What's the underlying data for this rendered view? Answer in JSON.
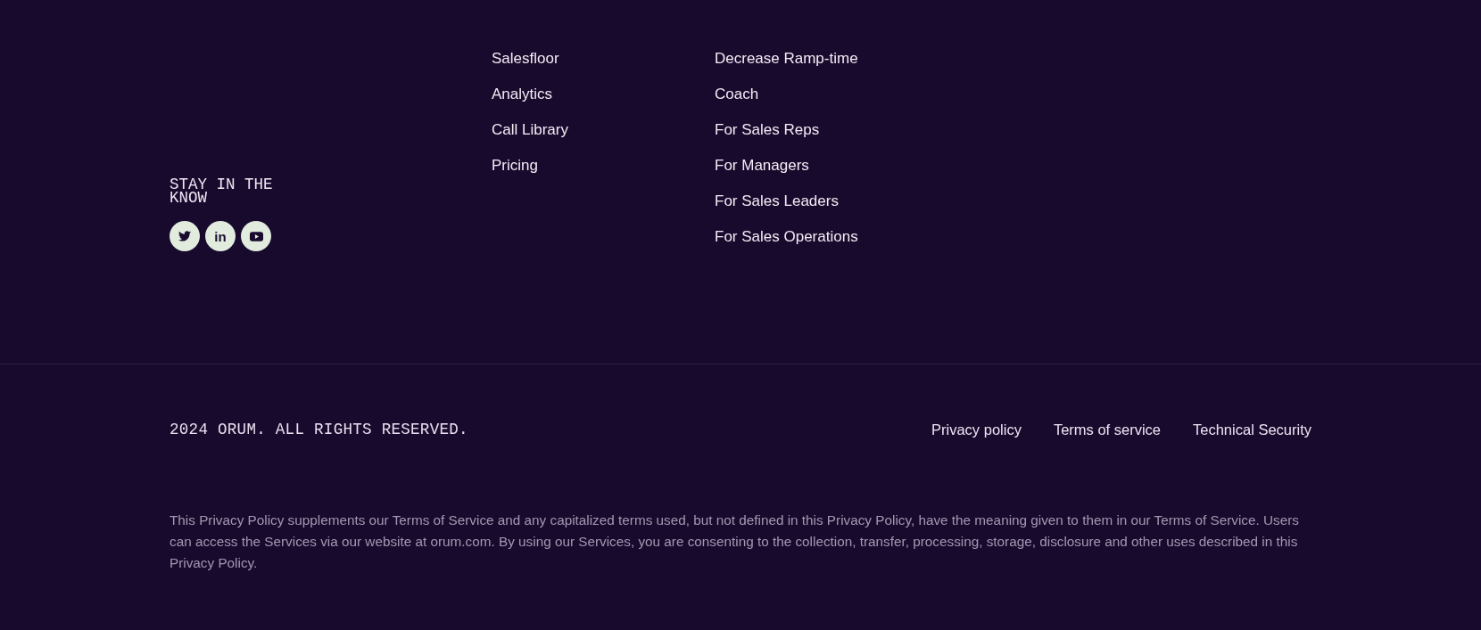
{
  "newsletter": {
    "heading": "STAY IN THE KNOW"
  },
  "social": [
    {
      "kind": "twitter"
    },
    {
      "kind": "linkedin",
      "label": "in"
    },
    {
      "kind": "youtube"
    }
  ],
  "nav_columns": [
    {
      "links": [
        "Salesfloor",
        "Analytics",
        "Call Library",
        "Pricing"
      ]
    },
    {
      "links": [
        "Decrease Ramp-time",
        "Coach",
        "For Sales Reps",
        "For Managers",
        "For Sales Leaders",
        "For Sales Operations"
      ]
    }
  ],
  "bottom_bar": {
    "copyright": "2024 ORUM. ALL RIGHTS RESERVED.",
    "links": [
      "Privacy policy",
      "Terms of service",
      "Technical Security"
    ]
  },
  "disclaimer": "This Privacy Policy supplements our Terms of Service and any capitalized terms used, but not defined in this Privacy Policy, have the meaning given to them in our Terms of Service. Users can access the Services via our website at orum.com. By using our Services, you are consenting to the collection, transfer, processing, storage, disclosure and other uses described in this Privacy Policy."
}
